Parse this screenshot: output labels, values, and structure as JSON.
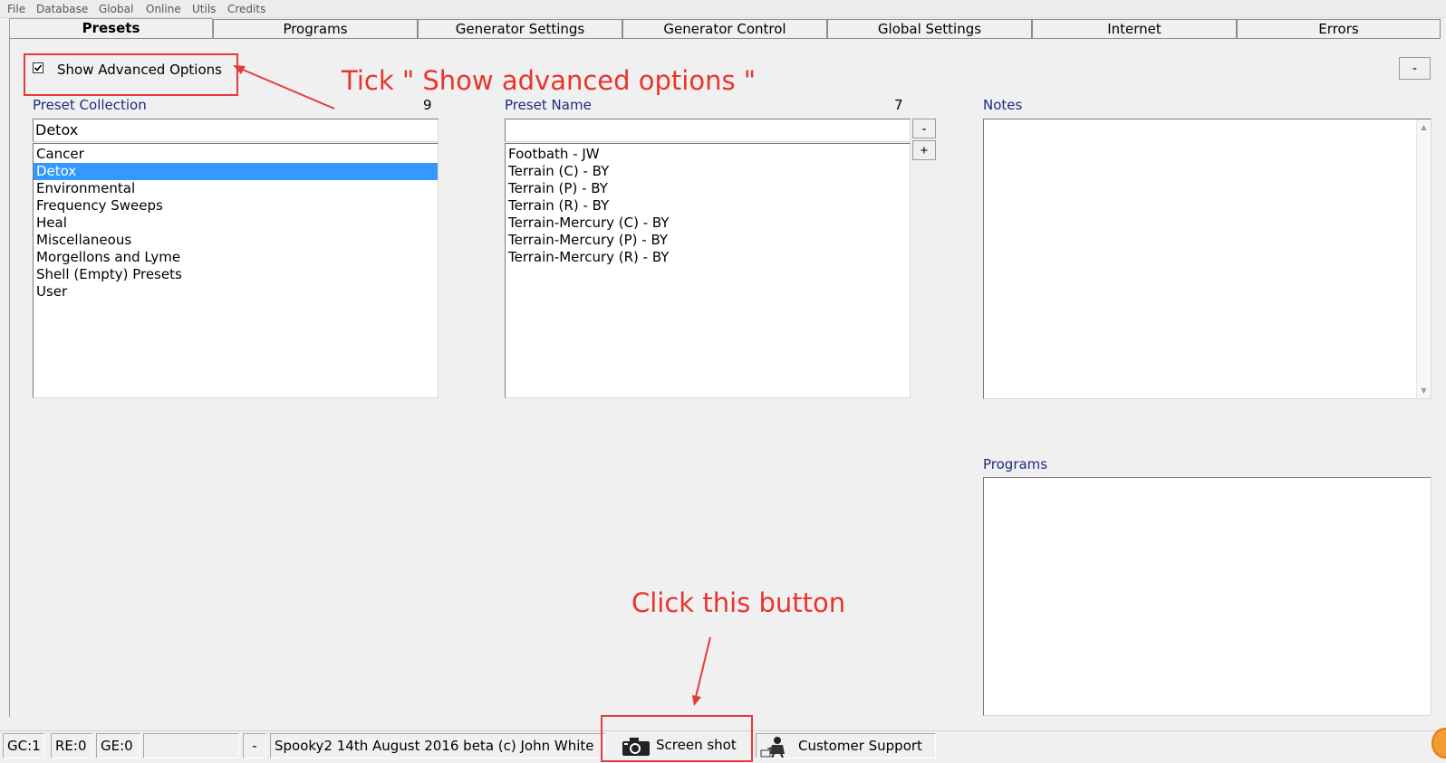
{
  "menu": [
    "File",
    "Database",
    "Global",
    "Online",
    "Utils",
    "Credits"
  ],
  "tabs": [
    "Presets",
    "Programs",
    "Generator Settings",
    "Generator Control",
    "Global Settings",
    "Internet",
    "Errors"
  ],
  "options": {
    "show_advanced_label": "Show Advanced Options",
    "show_advanced_checked": true,
    "collapse_button": "-"
  },
  "preset_collection": {
    "label": "Preset Collection",
    "count": "9",
    "value": "Detox",
    "items": [
      "Cancer",
      "Detox",
      "Environmental",
      "Frequency Sweeps",
      "Heal",
      "Miscellaneous",
      "Morgellons and Lyme",
      "Shell (Empty) Presets",
      "User"
    ],
    "selected": "Detox"
  },
  "preset_name": {
    "label": "Preset Name",
    "count": "7",
    "value": "",
    "minus_button": "-",
    "plus_button": "+",
    "items": [
      "Footbath - JW",
      "Terrain (C) - BY",
      "Terrain (P) - BY",
      "Terrain (R) - BY",
      "Terrain-Mercury (C) - BY",
      "Terrain-Mercury (P) - BY",
      "Terrain-Mercury (R) - BY"
    ]
  },
  "notes": {
    "label": "Notes"
  },
  "programs": {
    "label": "Programs"
  },
  "annotations": {
    "tick_text": "Tick \" Show advanced options \"",
    "click_text": "Click this button"
  },
  "statusbar": {
    "gc": "GC:1",
    "re": "RE:0",
    "ge": "GE:0",
    "empty": "",
    "dash": "-",
    "version": "Spooky2 14th August 2016 beta (c) John White",
    "screenshot_label": "Screen shot",
    "support_label": "Customer Support"
  },
  "colors": {
    "annotation": "#e53a3a",
    "selection": "#3399ff",
    "label": "#1f2a80"
  },
  "icons": {
    "camera": "camera-icon",
    "support": "customer-support-icon",
    "checkbox": "checkbox-checked-icon"
  }
}
